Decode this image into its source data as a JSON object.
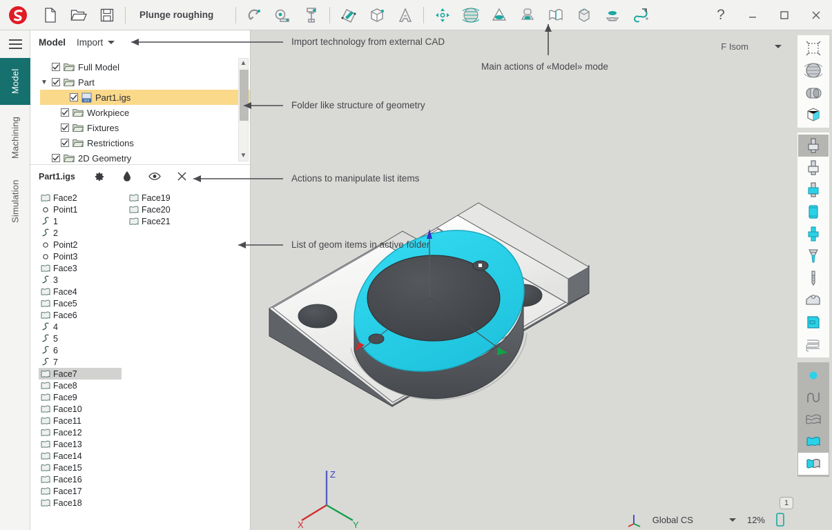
{
  "window": {
    "document_title": "Plunge roughing",
    "help_label": "?",
    "minimize_label": "—",
    "maximize_label": "□",
    "close_label": "✕"
  },
  "toolbar": {
    "logo_name": "sprut-logo",
    "file_actions": [
      {
        "name": "new-document-icon",
        "label": "New"
      },
      {
        "name": "open-folder-icon",
        "label": "Open"
      },
      {
        "name": "save-disk-icon",
        "label": "Save"
      }
    ],
    "main_actions": [
      {
        "name": "magnet-snap-icon",
        "label": "Snap"
      },
      {
        "name": "measure-icon",
        "label": "Measure"
      },
      {
        "name": "caliper-icon",
        "label": "Caliper"
      },
      {
        "name": "sketch-pencil-icon",
        "label": "Sketch"
      },
      {
        "name": "solid-box-icon",
        "label": "Solid"
      },
      {
        "name": "text-a-icon",
        "label": "Text"
      },
      {
        "name": "move-arrows-icon",
        "label": "Transform"
      },
      {
        "name": "mesh-sphere-icon",
        "label": "Mesh"
      },
      {
        "name": "cone-icon",
        "label": "Cone"
      },
      {
        "name": "revolve-icon",
        "label": "Revolve"
      },
      {
        "name": "surface-sheet-icon",
        "label": "Surface"
      },
      {
        "name": "extrude-box-icon",
        "label": "Extrude"
      },
      {
        "name": "pocket-icon",
        "label": "Pocket"
      },
      {
        "name": "curve-path-icon",
        "label": "Curve"
      }
    ]
  },
  "rail": {
    "menu_label": "Menu",
    "tabs": [
      {
        "label": "Model",
        "active": true
      },
      {
        "label": "Machining",
        "active": false
      },
      {
        "label": "Simulation",
        "active": false
      }
    ]
  },
  "panel": {
    "title": "Model",
    "import_label": "Import",
    "tree": [
      {
        "label": "Full Model",
        "checked": true,
        "depth": 0,
        "expandable": false,
        "selected": false,
        "icon": "folder-icon"
      },
      {
        "label": "Part",
        "checked": true,
        "depth": 0,
        "expandable": true,
        "expanded": true,
        "selected": false,
        "icon": "folder-icon"
      },
      {
        "label": "Part1.igs",
        "checked": true,
        "depth": 2,
        "expandable": false,
        "selected": true,
        "icon": "igs-file-icon"
      },
      {
        "label": "Workpiece",
        "checked": true,
        "depth": 1,
        "expandable": false,
        "selected": false,
        "icon": "folder-icon"
      },
      {
        "label": "Fixtures",
        "checked": true,
        "depth": 1,
        "expandable": false,
        "selected": false,
        "icon": "folder-icon"
      },
      {
        "label": "Restrictions",
        "checked": true,
        "depth": 1,
        "expandable": false,
        "selected": false,
        "icon": "folder-icon"
      },
      {
        "label": "2D Geometry",
        "checked": true,
        "depth": 0,
        "expandable": false,
        "selected": false,
        "icon": "folder-icon"
      }
    ],
    "list_header": {
      "title": "Part1.igs",
      "actions": [
        {
          "name": "gear-icon",
          "label": "Properties"
        },
        {
          "name": "droplet-color-icon",
          "label": "Color"
        },
        {
          "name": "eye-visibility-icon",
          "label": "Visibility"
        },
        {
          "name": "close-x-icon",
          "label": "Remove"
        }
      ]
    },
    "geom_column_1": [
      {
        "label": "Face2",
        "icon": "surface-icon",
        "selected": false
      },
      {
        "label": "Point1",
        "icon": "point-icon",
        "selected": false
      },
      {
        "label": "1",
        "icon": "curve-icon",
        "selected": false
      },
      {
        "label": "2",
        "icon": "curve-icon",
        "selected": false
      },
      {
        "label": "Point2",
        "icon": "point-icon",
        "selected": false
      },
      {
        "label": "Point3",
        "icon": "point-icon",
        "selected": false
      },
      {
        "label": "Face3",
        "icon": "surface-icon",
        "selected": false
      },
      {
        "label": "3",
        "icon": "curve-icon",
        "selected": false
      },
      {
        "label": "Face4",
        "icon": "surface-icon",
        "selected": false
      },
      {
        "label": "Face5",
        "icon": "surface-icon",
        "selected": false
      },
      {
        "label": "Face6",
        "icon": "surface-icon",
        "selected": false
      },
      {
        "label": "4",
        "icon": "curve-icon",
        "selected": false
      },
      {
        "label": "5",
        "icon": "curve-icon",
        "selected": false
      },
      {
        "label": "6",
        "icon": "curve-icon",
        "selected": false
      },
      {
        "label": "7",
        "icon": "curve-icon",
        "selected": false
      },
      {
        "label": "Face7",
        "icon": "surface-icon",
        "selected": true
      },
      {
        "label": "Face8",
        "icon": "surface-icon",
        "selected": false
      },
      {
        "label": "Face9",
        "icon": "surface-icon",
        "selected": false
      },
      {
        "label": "Face10",
        "icon": "surface-icon",
        "selected": false
      },
      {
        "label": "Face11",
        "icon": "surface-icon",
        "selected": false
      },
      {
        "label": "Face12",
        "icon": "surface-icon",
        "selected": false
      },
      {
        "label": "Face13",
        "icon": "surface-icon",
        "selected": false
      },
      {
        "label": "Face14",
        "icon": "surface-icon",
        "selected": false
      },
      {
        "label": "Face15",
        "icon": "surface-icon",
        "selected": false
      },
      {
        "label": "Face16",
        "icon": "surface-icon",
        "selected": false
      },
      {
        "label": "Face17",
        "icon": "surface-icon",
        "selected": false
      },
      {
        "label": "Face18",
        "icon": "surface-icon",
        "selected": false
      }
    ],
    "geom_column_2": [
      {
        "label": "Face19",
        "icon": "surface-icon",
        "selected": false
      },
      {
        "label": "Face20",
        "icon": "surface-icon",
        "selected": false
      },
      {
        "label": "Face21",
        "icon": "surface-icon",
        "selected": false
      }
    ]
  },
  "viewport": {
    "view_preset": "F Isom",
    "coordinate_system": "Global CS",
    "zoom_level": "12%",
    "layer_badge": "1",
    "axis_labels": {
      "x": "X",
      "y": "Y",
      "z": "Z"
    }
  },
  "callouts": [
    {
      "text": "Import technology from external CAD"
    },
    {
      "text": "Main actions of «Model» mode"
    },
    {
      "text": "Folder like structure of geometry"
    },
    {
      "text": "Actions to manipulate list items"
    },
    {
      "text": "List of geom items in active folder"
    }
  ],
  "right_rail": {
    "groups": [
      {
        "style": "white",
        "buttons": [
          {
            "name": "fit-to-screen-icon",
            "label": "Fit",
            "state": "normal"
          },
          {
            "name": "wireframe-sphere-icon",
            "label": "Wireframe",
            "state": "normal"
          },
          {
            "name": "shaded-solid-icon",
            "label": "Shaded",
            "state": "normal"
          },
          {
            "name": "section-box-icon",
            "label": "Section",
            "state": "normal"
          }
        ]
      },
      {
        "style": "white",
        "buttons": [
          {
            "name": "end-mill-tool-icon",
            "label": "End mill",
            "state": "active"
          },
          {
            "name": "shell-mill-tool-icon",
            "label": "Shell mill",
            "state": "normal"
          },
          {
            "name": "face-mill-tool-icon",
            "label": "Face mill",
            "state": "normal"
          },
          {
            "name": "slot-mill-tool-icon",
            "label": "Slot mill",
            "state": "normal"
          },
          {
            "name": "chamfer-mill-tool-icon",
            "label": "Chamfer mill",
            "state": "normal"
          },
          {
            "name": "taper-mill-tool-icon",
            "label": "Taper mill",
            "state": "normal"
          },
          {
            "name": "drill-tool-icon",
            "label": "Drill",
            "state": "normal"
          },
          {
            "name": "stock-block-icon",
            "label": "Stock",
            "state": "normal"
          },
          {
            "name": "fixture-clamp-icon",
            "label": "Fixture",
            "state": "normal"
          },
          {
            "name": "toolpath-hatch-icon",
            "label": "Toolpath",
            "state": "normal"
          }
        ]
      },
      {
        "style": "gray",
        "buttons": [
          {
            "name": "point-select-icon",
            "label": "Select point",
            "state": "active"
          },
          {
            "name": "curve-select-icon",
            "label": "Select curve",
            "state": "normal"
          },
          {
            "name": "mesh-select-icon",
            "label": "Select mesh",
            "state": "normal"
          },
          {
            "name": "surface-select-icon",
            "label": "Select surface",
            "state": "normal"
          },
          {
            "name": "solid-select-icon",
            "label": "Select solid",
            "state": "white"
          }
        ]
      }
    ]
  },
  "colors": {
    "accent_teal": "#16706e",
    "highlight_yellow": "#fbd98a",
    "selected_face_cyan": "#2ad2e8",
    "panel_bg": "#ffffff",
    "viewport_bg": "#d9d9d6",
    "axis_x": "#d42a2a",
    "axis_y": "#13a04a",
    "axis_z": "#3a3fc4"
  }
}
